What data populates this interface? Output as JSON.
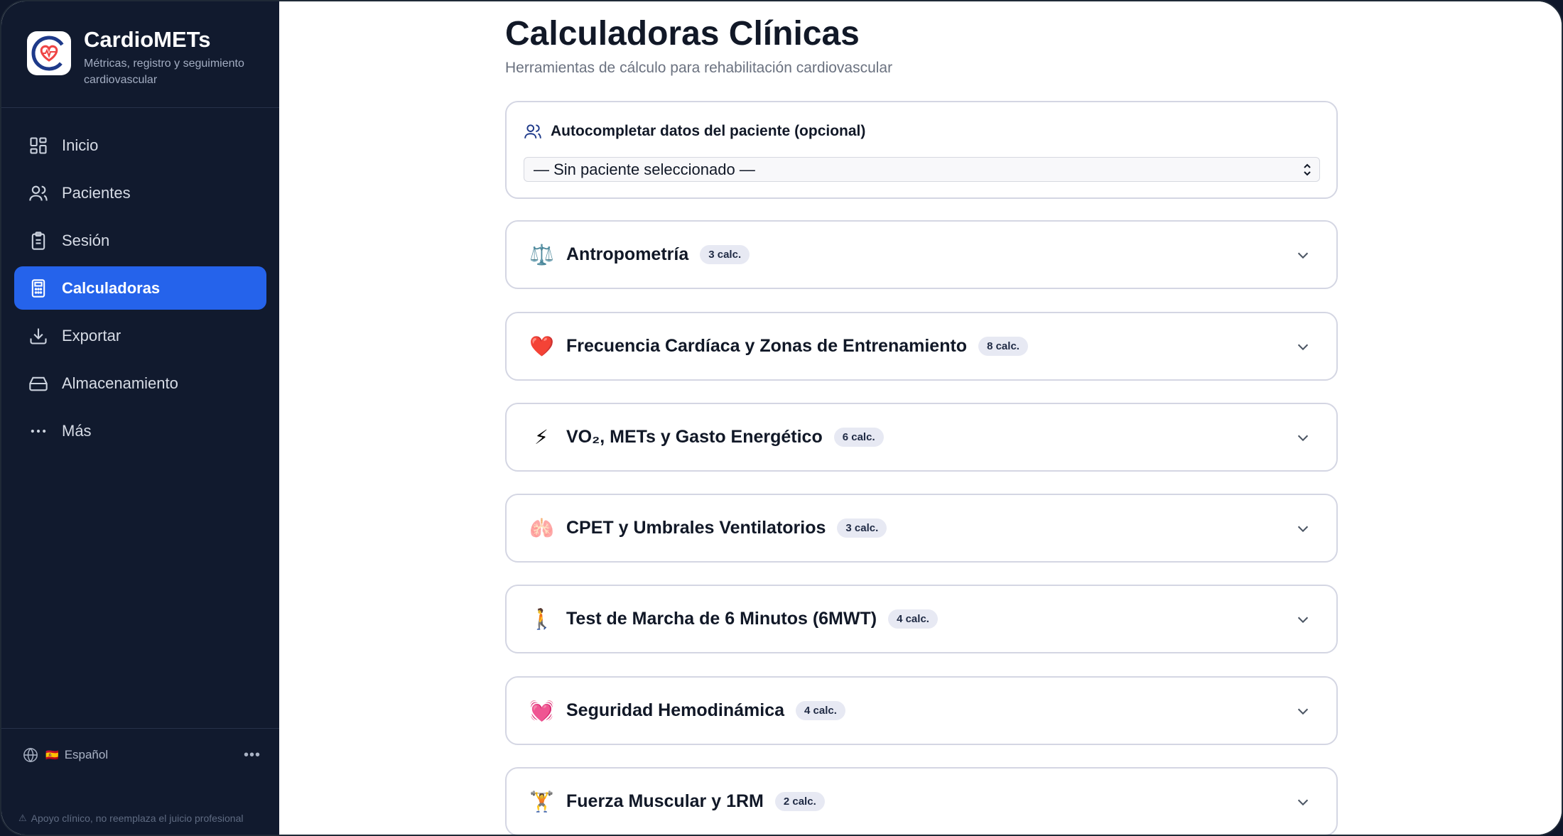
{
  "brand": {
    "title": "CardioMETs",
    "subtitle": "Métricas, registro y seguimiento cardiovascular"
  },
  "sidebar": {
    "items": [
      {
        "label": "Inicio",
        "icon": "dashboard-grid-icon",
        "active": false
      },
      {
        "label": "Pacientes",
        "icon": "users-icon",
        "active": false
      },
      {
        "label": "Sesión",
        "icon": "clipboard-icon",
        "active": false
      },
      {
        "label": "Calculadoras",
        "icon": "calculator-icon",
        "active": true
      },
      {
        "label": "Exportar",
        "icon": "download-icon",
        "active": false
      },
      {
        "label": "Almacenamiento",
        "icon": "hard-drive-icon",
        "active": false
      },
      {
        "label": "Más",
        "icon": "more-horizontal-icon",
        "active": false
      }
    ],
    "language": {
      "flag": "🇪🇸",
      "label": "Español"
    },
    "disclaimer": "Apoyo clínico, no reemplaza el juicio profesional"
  },
  "main": {
    "title": "Calculadoras Clínicas",
    "subtitle": "Herramientas de cálculo para rehabilitación cardiovascular",
    "patient": {
      "heading": "Autocompletar datos del paciente (opcional)",
      "selected": "— Sin paciente seleccionado —"
    },
    "categories": [
      {
        "emoji": "⚖️",
        "title": "Antropometría",
        "badge": "3 calc."
      },
      {
        "emoji": "❤️",
        "title": "Frecuencia Cardíaca y Zonas de Entrenamiento",
        "badge": "8 calc."
      },
      {
        "emoji": "⚡",
        "title": "VO₂, METs y Gasto Energético",
        "badge": "6 calc."
      },
      {
        "emoji": "🫁",
        "title": "CPET y Umbrales Ventilatorios",
        "badge": "3 calc."
      },
      {
        "emoji": "🚶",
        "title": "Test de Marcha de 6 Minutos (6MWT)",
        "badge": "4 calc."
      },
      {
        "emoji": "💓",
        "title": "Seguridad Hemodinámica",
        "badge": "4 calc."
      },
      {
        "emoji": "🏋️",
        "title": "Fuerza Muscular y 1RM",
        "badge": "2 calc."
      }
    ]
  },
  "colors": {
    "sidebar_bg": "#111a2e",
    "accent": "#2563eb",
    "card_border": "#d4d6e3",
    "badge_bg": "#e7e9f3"
  }
}
